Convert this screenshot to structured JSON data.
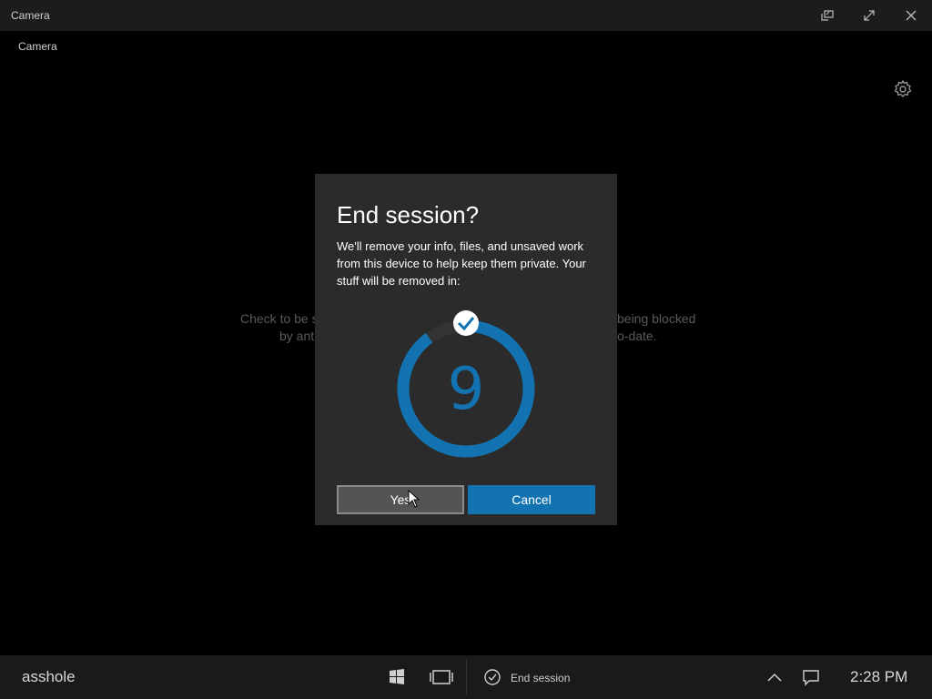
{
  "window": {
    "title": "Camera",
    "buttons": {
      "restore": "restore-icon",
      "maximize": "expand-icon",
      "close": "close-icon"
    }
  },
  "app": {
    "label": "Camera",
    "settings_icon": "gear-icon",
    "background_message": {
      "left_line1": "Check to be s",
      "left_line2": "by ant",
      "right_line1": "being blocked",
      "right_line2": "o-date."
    }
  },
  "dialog": {
    "title": "End session?",
    "body": "We'll remove your info, files, and unsaved work from this device to help keep them private. Your stuff will be removed in:",
    "countdown": "9",
    "countdown_progress": 0.9,
    "check_icon": "checkmark-icon",
    "yes_label": "Yes",
    "cancel_label": "Cancel",
    "accent_color": "#1273b0"
  },
  "taskbar": {
    "user": "asshole",
    "end_session_label": "End session",
    "time": "2:28 PM",
    "icons": [
      "windows-start-icon",
      "task-view-icon",
      "end-session-check-icon",
      "tray-chevron-up-icon",
      "action-center-icon"
    ]
  }
}
